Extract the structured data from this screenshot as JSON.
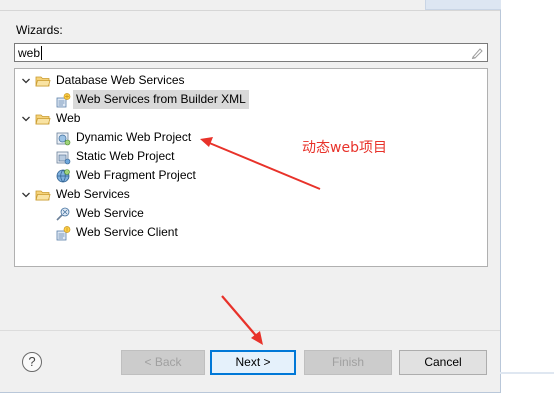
{
  "wizards": {
    "label": "Wizards:",
    "filter_value": "web"
  },
  "tree": {
    "items": [
      {
        "label": "Database Web Services",
        "icon": "folder-icon",
        "expanded": true
      },
      {
        "label": "Web Services from Builder XML",
        "icon": "web-services-builder-icon",
        "selected": true
      },
      {
        "label": "Web",
        "icon": "folder-icon",
        "expanded": true
      },
      {
        "label": "Dynamic Web Project",
        "icon": "dynamic-web-project-icon"
      },
      {
        "label": "Static Web Project",
        "icon": "static-web-project-icon"
      },
      {
        "label": "Web Fragment Project",
        "icon": "web-fragment-project-icon"
      },
      {
        "label": "Web Services",
        "icon": "folder-icon",
        "expanded": true
      },
      {
        "label": "Web Service",
        "icon": "web-service-icon"
      },
      {
        "label": "Web Service Client",
        "icon": "web-service-client-icon"
      }
    ]
  },
  "annotation": {
    "text": "动态web项目",
    "color": "#e8322a"
  },
  "buttons": {
    "help": "?",
    "back": "< Back",
    "next": "Next >",
    "finish": "Finish",
    "cancel": "Cancel"
  },
  "colors": {
    "folder": "#e8b84a",
    "accent": "#0078d7"
  }
}
